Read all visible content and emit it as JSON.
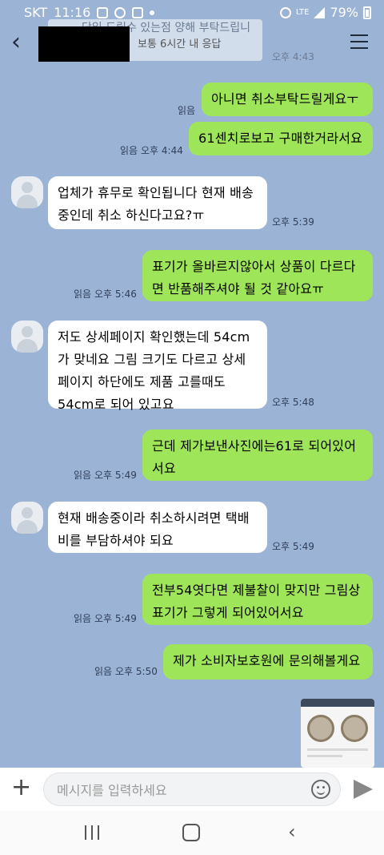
{
  "status_bar": {
    "carrier": "SKT",
    "time": "11:16",
    "network": "LTE",
    "battery": "79%"
  },
  "header": {
    "faded_title": "당일 드릴수 있는점 양해 부탁드립니",
    "response_time": "보통 6시간 내 응답",
    "faded_time": "오후 4:43"
  },
  "messages": [
    {
      "dir": "out",
      "text": "아니면 취소부탁드릴게요ㅜ",
      "read": "읽음",
      "time": ""
    },
    {
      "dir": "out",
      "text": "61센치로보고 구매한거라서요",
      "read": "읽음",
      "time": "오후 4:44"
    },
    {
      "dir": "in",
      "text": "업체가 휴무로 확인됩니다 현재 배송 중인데 취소 하신다고요?ㅠ",
      "read": "",
      "time": "오후 5:39"
    },
    {
      "dir": "out",
      "text": "표기가 올바르지않아서 상품이 다르다면 반품해주셔야 될 것 같아요ㅠ",
      "read": "읽음",
      "time": "오후 5:46"
    },
    {
      "dir": "in",
      "text": "저도 상세페이지 확인했는데 54cm가 맞네요 그림 크기도 다르고 상세페이지 하단에도 제품 고를때도 54cm로 되어 있고요",
      "read": "",
      "time": "오후 5:48"
    },
    {
      "dir": "out",
      "text": "근데 제가보낸사진에는61로 되어있어서요",
      "read": "읽음",
      "time": "오후 5:49"
    },
    {
      "dir": "in",
      "text": "현재 배송중이라 취소하시려면 택배비를 부담하셔야 되요",
      "read": "",
      "time": "오후 5:49"
    },
    {
      "dir": "out",
      "text": "전부54엿다면 제불찰이 맞지만 그림상표기가 그렇게 되어있어서요",
      "read": "읽음",
      "time": "오후 5:49"
    },
    {
      "dir": "out",
      "text": "제가 소비자보호원에 문의해볼게요",
      "read": "읽음",
      "time": "오후 5:50"
    }
  ],
  "input": {
    "placeholder": "메시지를 입력하세요"
  },
  "colors": {
    "background": "#9bb3d5",
    "outgoing": "#9ee55a",
    "incoming": "#ffffff"
  },
  "icons": [
    "back-arrow-icon",
    "menu-icon",
    "plus-icon",
    "emoji-icon",
    "send-icon"
  ]
}
